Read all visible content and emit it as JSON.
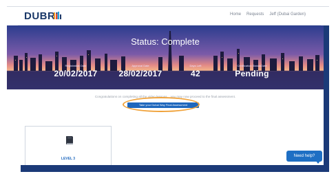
{
  "header": {
    "logo_text": "DUBRI",
    "nav": [
      "Home",
      "Requests",
      "Jeff (Dubai Garden)"
    ]
  },
  "hero": {
    "title": "Status: Complete",
    "stats": [
      {
        "label": "Registration Date",
        "value": "20/02/2017"
      },
      {
        "label": "Approval Date",
        "value": "28/02/2017"
      },
      {
        "label": "Days Left",
        "value": "42"
      },
      {
        "label": "Certification Status/Date",
        "value": "Pending"
      }
    ]
  },
  "message": "Congratulations on completing all the video lessons... you may now proceed to the final assessment.",
  "final_button_label": "Take your Dubai Way Final Assessment",
  "level_card": {
    "label": "LEVEL 3"
  },
  "help_button_label": "Need help?",
  "colors": {
    "accent": "#1e67bd",
    "brand_navy": "#1b3a78",
    "highlight": "#f0a23a"
  }
}
